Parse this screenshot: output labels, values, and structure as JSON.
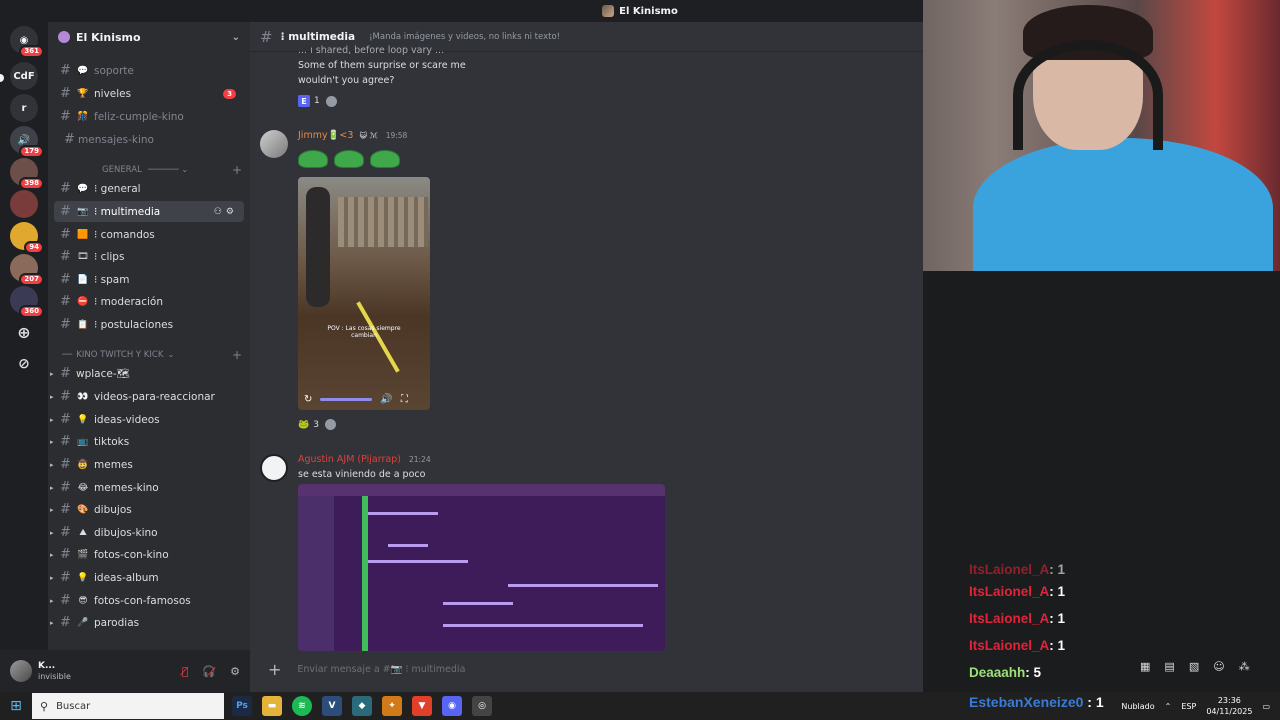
{
  "window": {
    "title": "El Kinismo"
  },
  "rail": {
    "servers": [
      {
        "name": "discord-home",
        "badge": "361"
      },
      {
        "name": "CdF",
        "badge": ""
      },
      {
        "name": "r",
        "badge": ""
      },
      {
        "name": "server-4",
        "badge": "179"
      },
      {
        "name": "server-5",
        "badge": "398"
      },
      {
        "name": "server-6",
        "badge": ""
      },
      {
        "name": "server-7",
        "badge": "94"
      },
      {
        "name": "server-8",
        "badge": "207"
      },
      {
        "name": "server-9",
        "badge": "360"
      }
    ]
  },
  "sidebar": {
    "guild_name": "El Kinismo",
    "top_channels": [
      {
        "emoji": "💬",
        "label": "soporte",
        "muted": true,
        "badge": ""
      },
      {
        "emoji": "🏆",
        "label": "niveles",
        "muted": false,
        "badge": "3"
      },
      {
        "emoji": "🎊",
        "label": "feliz-cumple-kino",
        "muted": true,
        "badge": ""
      },
      {
        "emoji": "",
        "label": "mensajes-kino",
        "muted": true,
        "badge": ""
      }
    ],
    "category_general": "GENERAL",
    "general_channels": [
      {
        "emoji": "💬",
        "label": "⁝ general"
      },
      {
        "emoji": "📷",
        "label": "⁝ multimedia"
      },
      {
        "emoji": "🟧",
        "label": "⁝ comandos"
      },
      {
        "emoji": "🎞",
        "label": "⁝ clips"
      },
      {
        "emoji": "📄",
        "label": "⁝ spam"
      },
      {
        "emoji": "⛔",
        "label": "⁝ moderación"
      },
      {
        "emoji": "📋",
        "label": "⁝ postulaciones"
      }
    ],
    "category_kino": "KINO TWITCH Y KICK",
    "kino_channels": [
      {
        "emoji": "",
        "label": "wplace-🗺"
      },
      {
        "emoji": "👀",
        "label": "videos-para-reaccionar"
      },
      {
        "emoji": "💡",
        "label": "ideas-videos"
      },
      {
        "emoji": "📺",
        "label": "tiktoks"
      },
      {
        "emoji": "🤠",
        "label": "memes"
      },
      {
        "emoji": "😂",
        "label": "memes-kino"
      },
      {
        "emoji": "🎨",
        "label": "dibujos"
      },
      {
        "emoji": "⛰",
        "label": "dibujos-kino"
      },
      {
        "emoji": "🎬",
        "label": "fotos-con-kino"
      },
      {
        "emoji": "💡",
        "label": "ideas-album"
      },
      {
        "emoji": "😎",
        "label": "fotos-con-famosos"
      },
      {
        "emoji": "🎤",
        "label": "parodias"
      }
    ]
  },
  "user_panel": {
    "name": "K...",
    "status": "invisible"
  },
  "chat": {
    "channel_name": "⁝ multimedia",
    "topic": "¡Manda imágenes y videos, no links ni texto!",
    "msg1_line0": "... ı shared, before loop vary ...",
    "msg1_line1": "Some of them surprise or scare me",
    "msg1_line2": "wouldn't you agree?",
    "msg1_reaction_count": "1",
    "msg2_author": "Jimmy🔋<3",
    "msg2_tag": "😺 ℳ",
    "msg2_time": "19:58",
    "video_overlay_text": "POV : Las cosas siempre cambian",
    "msg2_reaction_count": "3",
    "msg3_author": "Agustin AJM (Pijarrap)",
    "msg3_time": "21:24",
    "msg3_text": "se esta viniendo de a poco",
    "input_placeholder": "Enviar mensaje a #📷 ⁝ multimedia"
  },
  "stream_chat": [
    {
      "name": "ItsLaionel_A",
      "value": " : 1"
    },
    {
      "name": "ItsLaionel_A",
      "value": " : 1"
    },
    {
      "name": "ItsLaionel_A",
      "value": " : 1"
    },
    {
      "name": "ItsLaionel_A",
      "value": " : 1"
    },
    {
      "name": "Deaaahh",
      "value": " : 5"
    }
  ],
  "stream_chat_last": {
    "name": "EstebanXeneize0",
    "value": " : 1"
  },
  "taskbar": {
    "search_placeholder": "Buscar",
    "nublado": "Nublado",
    "lang": "ESP",
    "time": "23:36",
    "date": "04/11/2025"
  },
  "colors": {
    "accent": "#5865f2",
    "danger": "#f23f43",
    "sidebar": "#2b2d31",
    "chat": "#313338"
  }
}
